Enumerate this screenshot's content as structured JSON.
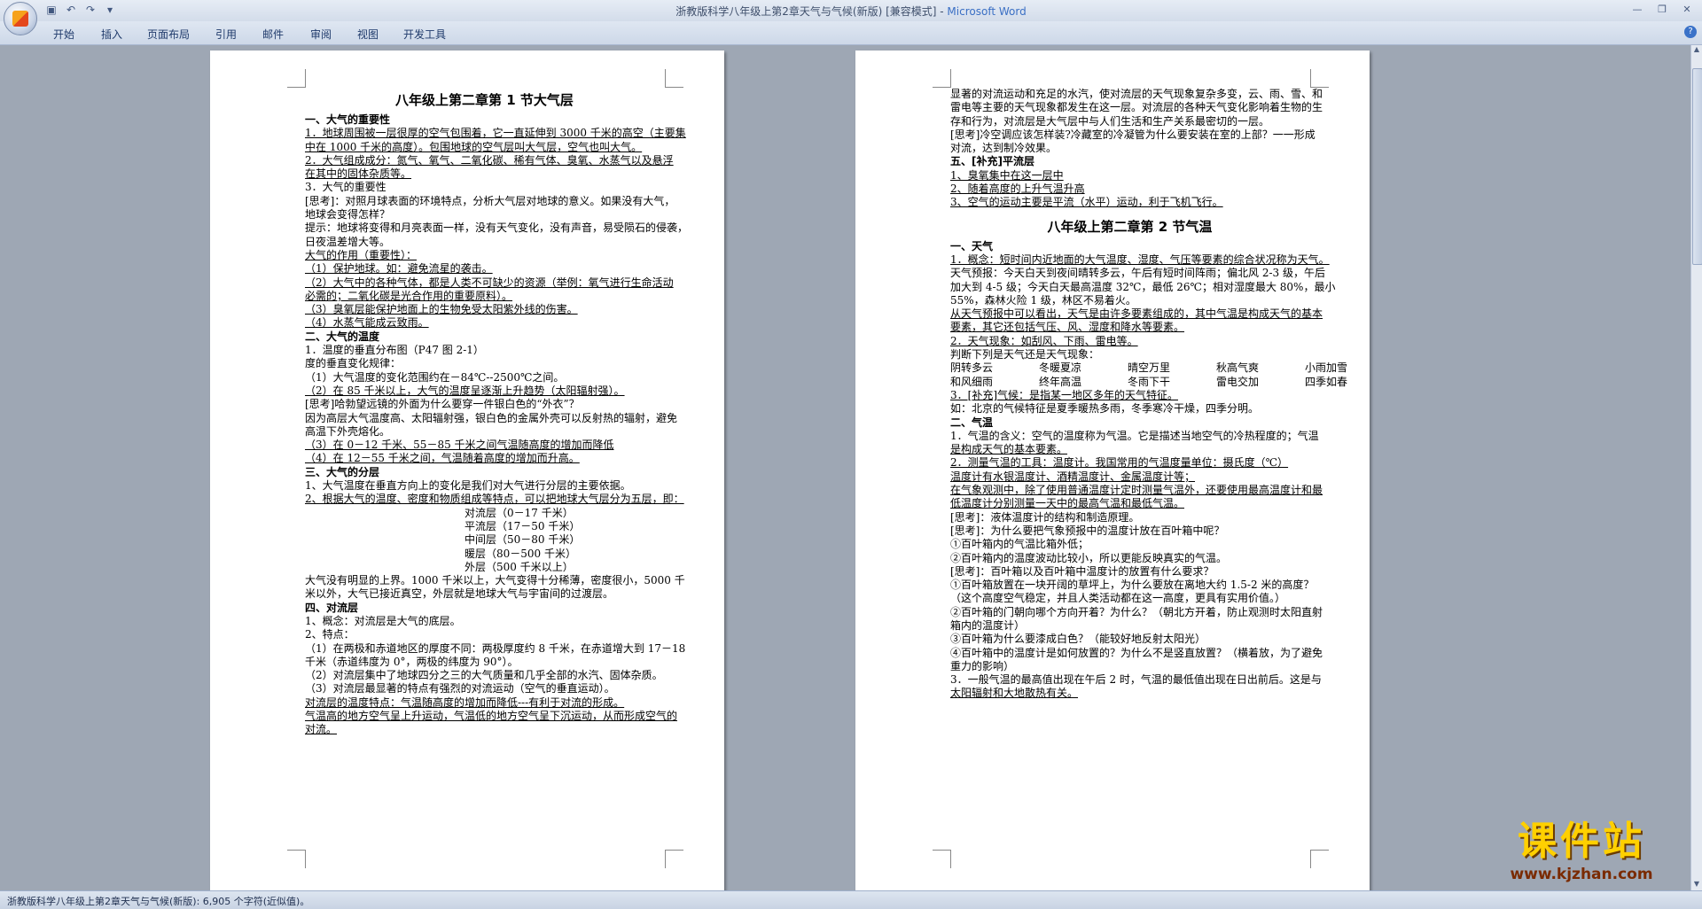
{
  "window": {
    "title_doc": "浙教版科学八年级上第2章天气与气候(新版) [兼容模式] - ",
    "title_app": "Microsoft Word"
  },
  "quick_access": [
    "save-icon",
    "undo-icon",
    "redo-icon",
    "customize-icon"
  ],
  "ribbon_tabs": [
    "开始",
    "插入",
    "页面布局",
    "引用",
    "邮件",
    "审阅",
    "视图",
    "开发工具"
  ],
  "status_bar": {
    "text": "浙教版科学八年级上第2章天气与气候(新版): 6,905 个字符(近似值)。"
  },
  "watermark": {
    "text": "课件站",
    "url": "www.kjzhan.com"
  },
  "left_page": {
    "title": "八年级上第二章第 1 节大气层",
    "lines": [
      {
        "t": "一、大气的重要性",
        "c": "h"
      },
      {
        "t": "1．地球周围被一层很厚的空气包围着，它一直延伸到 3000 千米的高空（主要集",
        "c": "u"
      },
      {
        "t": "中在 1000 千米的高度）。包围地球的空气层叫大气层，空气也叫大气。",
        "c": "u"
      },
      {
        "t": "2．大气组成成分：氮气、氧气、二氧化碳、稀有气体、臭氧、水蒸气以及悬浮",
        "c": "u"
      },
      {
        "t": "在其中的固体杂质等。",
        "c": "u"
      },
      {
        "t": "3．大气的重要性",
        "c": ""
      },
      {
        "t": "[思考]：对照月球表面的环境特点，分析大气层对地球的意义。如果没有大气，",
        "c": ""
      },
      {
        "t": "地球会变得怎样？",
        "c": ""
      },
      {
        "t": "提示：地球将变得和月亮表面一样，没有天气变化，没有声音，易受陨石的侵袭，",
        "c": ""
      },
      {
        "t": "日夜温差增大等。",
        "c": ""
      },
      {
        "t": "大气的作用（重要性）：",
        "c": "u"
      },
      {
        "t": "（1）保护地球。如：避免流星的袭击。",
        "c": "u"
      },
      {
        "t": "（2）大气中的各种气体，都是人类不可缺少的资源（举例：氧气进行生命活动",
        "c": "u"
      },
      {
        "t": "必需的；二氧化碳是光合作用的重要原料）。",
        "c": "u"
      },
      {
        "t": "（3）臭氧层能保护地面上的生物免受太阳紫外线的伤害。",
        "c": "u"
      },
      {
        "t": "（4）水蒸气能成云致雨。",
        "c": "u"
      },
      {
        "t": "二、大气的温度",
        "c": "h"
      },
      {
        "t": "1．温度的垂直分布图（P47   图 2-1）",
        "c": ""
      },
      {
        "t": "度的垂直变化规律：",
        "c": ""
      },
      {
        "t": "（1）大气温度的变化范围约在－84℃--2500℃之间。",
        "c": ""
      },
      {
        "t": "（2）在 85 千米以上，大气的温度呈逐渐上升趋势（太阳辐射强）。",
        "c": "u"
      },
      {
        "t": "[思考]哈勃望远镜的外面为什么要穿一件银白色的“外衣”？",
        "c": ""
      },
      {
        "t": "因为高层大气温度高、太阳辐射强，银白色的金属外壳可以反射热的辐射，避免",
        "c": ""
      },
      {
        "t": "高温下外壳熔化。",
        "c": ""
      },
      {
        "t": "（3）在 0－12 千米、55－85 千米之间气温随高度的增加而降低",
        "c": "u"
      },
      {
        "t": "（4）在 12－55 千米之间，气温随着高度的增加而升高。",
        "c": "u"
      },
      {
        "t": "三、大气的分层",
        "c": "h"
      },
      {
        "t": "1、大气温度在垂直方向上的变化是我们对大气进行分层的主要依据。",
        "c": ""
      },
      {
        "t": "2、根据大气的温度、密度和物质组成等特点，可以把地球大气层分为五层，即：",
        "c": "u"
      },
      {
        "t": "对流层（0－17 千米）",
        "c": "indent"
      },
      {
        "t": "平流层（17－50 千米）",
        "c": "indent"
      },
      {
        "t": "中间层（50－80 千米）",
        "c": "indent"
      },
      {
        "t": "暖层（80－500 千米）",
        "c": "indent"
      },
      {
        "t": "外层（500 千米以上）",
        "c": "indent"
      },
      {
        "t": "大气没有明显的上界。1000 千米以上，大气变得十分稀薄，密度很小，5000 千",
        "c": ""
      },
      {
        "t": "米以外，大气已接近真空，外层就是地球大气与宇宙间的过渡层。",
        "c": ""
      },
      {
        "t": "四、对流层",
        "c": "h"
      },
      {
        "t": "1、概念：对流层是大气的底层。",
        "c": ""
      },
      {
        "t": "2、特点：",
        "c": ""
      },
      {
        "t": "（1）在两极和赤道地区的厚度不同：两极厚度约 8 千米，在赤道增大到 17－18",
        "c": ""
      },
      {
        "t": "千米（赤道纬度为 0°，两极的纬度为 90°）。",
        "c": ""
      },
      {
        "t": "（2）对流层集中了地球四分之三的大气质量和几乎全部的水汽、固体杂质。",
        "c": ""
      },
      {
        "t": "（3）对流层最显著的特点有强烈的对流运动（空气的垂直运动）。",
        "c": ""
      },
      {
        "t": "对流层的温度特点：气温随高度的增加而降低---有利于对流的形成。",
        "c": "u"
      },
      {
        "t": "气温高的地方空气呈上升运动，气温低的地方空气呈下沉运动，从而形成空气的",
        "c": "u"
      },
      {
        "t": "对流。",
        "c": "u"
      }
    ]
  },
  "right_page": {
    "lines_top": [
      {
        "t": "显著的对流运动和充足的水汽，使对流层的天气现象复杂多变，云、雨、雪、和",
        "c": ""
      },
      {
        "t": "雷电等主要的天气现象都发生在这一层。对流层的各种天气变化影响着生物的生",
        "c": ""
      },
      {
        "t": "存和行为，对流层是大气层中与人们生活和生产关系最密切的一层。",
        "c": ""
      },
      {
        "t": "[思考]冷空调应该怎样装?冷藏室的冷凝管为什么要安装在室的上部？一一形成",
        "c": ""
      },
      {
        "t": "对流，达到制冷效果。",
        "c": ""
      },
      {
        "t": "五、[补充]平流层",
        "c": "h"
      },
      {
        "t": "1、臭氧集中在这一层中",
        "c": "u"
      },
      {
        "t": "2、随着高度的上升气温升高",
        "c": "u"
      },
      {
        "t": "3、空气的运动主要是平流（水平）运动，利于飞机飞行。",
        "c": "u"
      }
    ],
    "title": "八年级上第二章第 2 节气温",
    "lines_mid": [
      {
        "t": "一、天气",
        "c": "h"
      },
      {
        "t": "1．概念：短时间内近地面的大气温度、湿度、气压等要素的综合状况称为天气。",
        "c": "u"
      },
      {
        "t": "天气预报：今天白天到夜间晴转多云，午后有短时间阵雨；偏北风 2-3 级，午后",
        "c": ""
      },
      {
        "t": "加大到 4-5 级；今天白天最高温度 32℃，最低 26℃；相对湿度最大 80%，最小",
        "c": ""
      },
      {
        "t": "55%，森林火险 1 级，林区不易着火。",
        "c": ""
      },
      {
        "t": "从天气预报中可以看出，天气是由许多要素组成的，其中气温是构成天气的基本",
        "c": "u"
      },
      {
        "t": "要素，其它还包括气压、风、湿度和降水等要素。",
        "c": "u"
      },
      {
        "t": "2．天气现象：如刮风、下雨、雷电等。",
        "c": "u"
      },
      {
        "t": "判断下列是天气还是天气现象：",
        "c": ""
      }
    ],
    "grid": [
      [
        "阴转多云",
        "冬暖夏凉",
        "晴空万里",
        "秋高气爽",
        "小雨加雪"
      ],
      [
        "和风细雨",
        "终年高温",
        "冬雨下干",
        "雷电交加",
        "四季如春"
      ]
    ],
    "lines_bottom": [
      {
        "t": "3．[补充]气候：是指某一地区多年的天气特征。",
        "c": "u"
      },
      {
        "t": "如：北京的气候特征是夏季暖热多雨，冬季寒冷干燥，四季分明。",
        "c": ""
      },
      {
        "t": "二、气温",
        "c": "h"
      },
      {
        "t": "1．气温的含义：空气的温度称为气温。它是描述当地空气的冷热程度的；气温",
        "c": ""
      },
      {
        "t": "是构成天气的基本要素。",
        "c": "u"
      },
      {
        "t": "2．测量气温的工具：温度计。我国常用的气温度量单位：摄氏度（℃）",
        "c": "u"
      },
      {
        "t": "温度计有水银温度计、酒精温度计、金属温度计等；",
        "c": "u"
      },
      {
        "t": "在气象观测中，除了使用普通温度计定时测量气温外，还要使用最高温度计和最",
        "c": "u"
      },
      {
        "t": "低温度计分别测量一天中的最高气温和最低气温。",
        "c": "u"
      },
      {
        "t": "[思考]：液体温度计的结构和制造原理。",
        "c": ""
      },
      {
        "t": "[思考]：为什么要把气象预报中的温度计放在百叶箱中呢？",
        "c": ""
      },
      {
        "t": "①百叶箱内的气温比箱外低；",
        "c": ""
      },
      {
        "t": "②百叶箱内的温度波动比较小，所以更能反映真实的气温。",
        "c": ""
      },
      {
        "t": "[思考]：百叶箱以及百叶箱中温度计的放置有什么要求？",
        "c": ""
      },
      {
        "t": "①百叶箱放置在一块开阔的草坪上，为什么要放在离地大约 1.5-2 米的高度？",
        "c": ""
      },
      {
        "t": "（这个高度空气稳定，并且人类活动都在这一高度，更具有实用价值。）",
        "c": ""
      },
      {
        "t": "②百叶箱的门朝向哪个方向开着？为什么？（朝北方开着，防止观测时太阳直射",
        "c": ""
      },
      {
        "t": "箱内的温度计）",
        "c": ""
      },
      {
        "t": "③百叶箱为什么要漆成白色？（能较好地反射太阳光）",
        "c": ""
      },
      {
        "t": "④百叶箱中的温度计是如何放置的？为什么不是竖直放置？（横着放，为了避免",
        "c": ""
      },
      {
        "t": "重力的影响）",
        "c": ""
      },
      {
        "t": "3．一般气温的最高值出现在午后 2 时，气温的最低值出现在日出前后。这是与",
        "c": ""
      },
      {
        "t": "太阳辐射和大地散热有关。",
        "c": "u"
      }
    ]
  }
}
